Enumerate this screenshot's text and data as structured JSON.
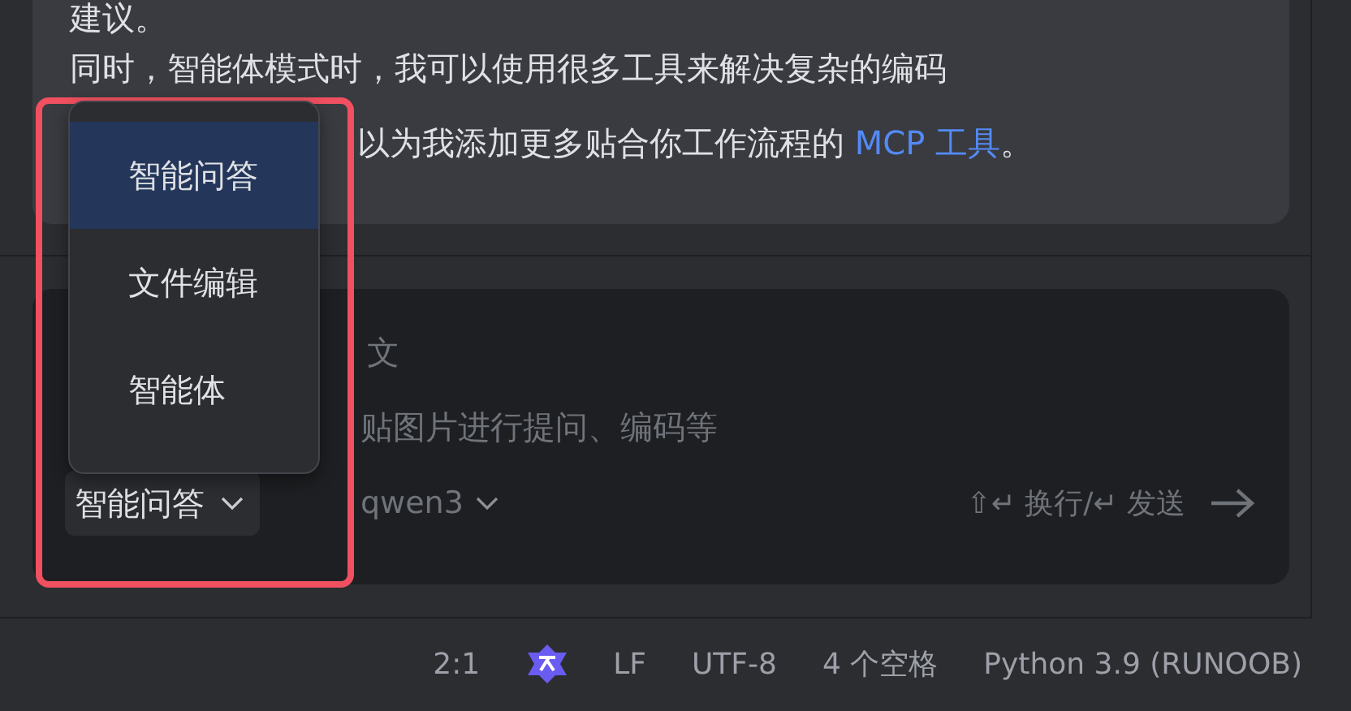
{
  "message": {
    "line_1": "建议。",
    "line_2": "同时，智能体模式时，我可以使用很多工具来解决复杂的编码",
    "line_3": "以为我添加更多贴合你工作流程的 ",
    "link": "MCP 工具",
    "line_3_end": "。"
  },
  "input": {
    "placeholder_lines": [
      "文",
      "贴图片进行提问、编码等"
    ],
    "mode_button": "智能问答",
    "model_button": "qwen3",
    "hint": "⇧↵ 换行/↵ 发送"
  },
  "menu": {
    "items": [
      {
        "label": "智能问答",
        "selected": true
      },
      {
        "label": "文件编辑",
        "selected": false
      },
      {
        "label": "智能体",
        "selected": false
      }
    ]
  },
  "status_bar": [
    {
      "kind": "text",
      "text": "2:1"
    },
    {
      "kind": "logo"
    },
    {
      "kind": "text",
      "text": "LF"
    },
    {
      "kind": "text",
      "text": "UTF-8"
    },
    {
      "kind": "text",
      "text": "4 个空格"
    },
    {
      "kind": "text",
      "text": "Python 3.9 (RUNOOB)"
    }
  ]
}
